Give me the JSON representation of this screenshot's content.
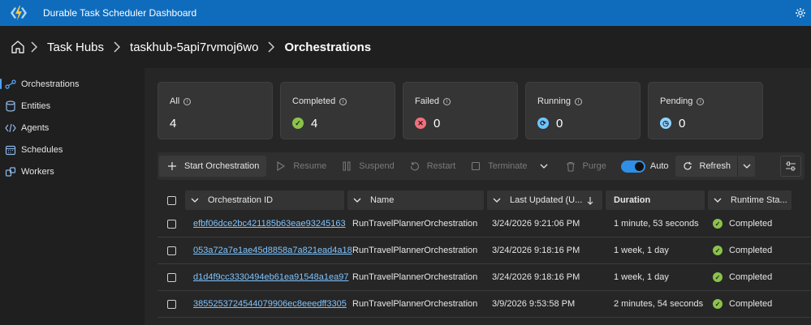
{
  "app": {
    "title": "Durable Task Scheduler Dashboard",
    "logo_icon": "azure-functions-icon",
    "accent": "#0f6cbd"
  },
  "breadcrumb": {
    "items": [
      "Task Hubs",
      "taskhub-5api7rvmoj6wo"
    ],
    "current": "Orchestrations"
  },
  "sidebar": {
    "items": [
      {
        "label": "Orchestrations",
        "icon": "orchestrations-icon",
        "active": true
      },
      {
        "label": "Entities",
        "icon": "database-icon"
      },
      {
        "label": "Agents",
        "icon": "code-icon"
      },
      {
        "label": "Schedules",
        "icon": "calendar-icon"
      },
      {
        "label": "Workers",
        "icon": "workers-icon"
      }
    ]
  },
  "cards": [
    {
      "label": "All",
      "value": "4"
    },
    {
      "label": "Completed",
      "value": "4",
      "icon": "check-icon",
      "color": "#8bc34a"
    },
    {
      "label": "Failed",
      "value": "0",
      "icon": "error-icon",
      "color": "#f1707b"
    },
    {
      "label": "Running",
      "value": "0",
      "icon": "sync-icon",
      "color": "#6cc6ff"
    },
    {
      "label": "Pending",
      "value": "0",
      "icon": "clock-icon",
      "color": "#8fd3ff"
    }
  ],
  "toolbar": {
    "start": "Start Orchestration",
    "resume": "Resume",
    "suspend": "Suspend",
    "restart": "Restart",
    "terminate": "Terminate",
    "purge": "Purge",
    "auto": "Auto",
    "refresh": "Refresh"
  },
  "table": {
    "columns": [
      "Orchestration ID",
      "Name",
      "Last Updated (U...",
      "Duration",
      "Runtime Sta..."
    ],
    "rows": [
      {
        "id": "efbf06dce2bc421185b63eae93245163",
        "name": "RunTravelPlannerOrchestration",
        "updated": "3/24/2026 9:21:06 PM",
        "duration": "1 minute, 53 seconds",
        "status": "Completed"
      },
      {
        "id": "053a72a7e1ae45d8858a7a821ead4a18",
        "name": "RunTravelPlannerOrchestration",
        "updated": "3/24/2026 9:18:16 PM",
        "duration": "1 week, 1 day",
        "status": "Completed"
      },
      {
        "id": "d1d4f9cc3330494eb61ea91548a1ea97",
        "name": "RunTravelPlannerOrchestration",
        "updated": "3/24/2026 9:18:16 PM",
        "duration": "1 week, 1 day",
        "status": "Completed"
      },
      {
        "id": "385525372454407990​6ec8eeedff3305",
        "name": "RunTravelPlannerOrchestration",
        "updated": "3/9/2026 9:53:58 PM",
        "duration": "2 minutes, 54 seconds",
        "status": "Completed"
      }
    ]
  }
}
